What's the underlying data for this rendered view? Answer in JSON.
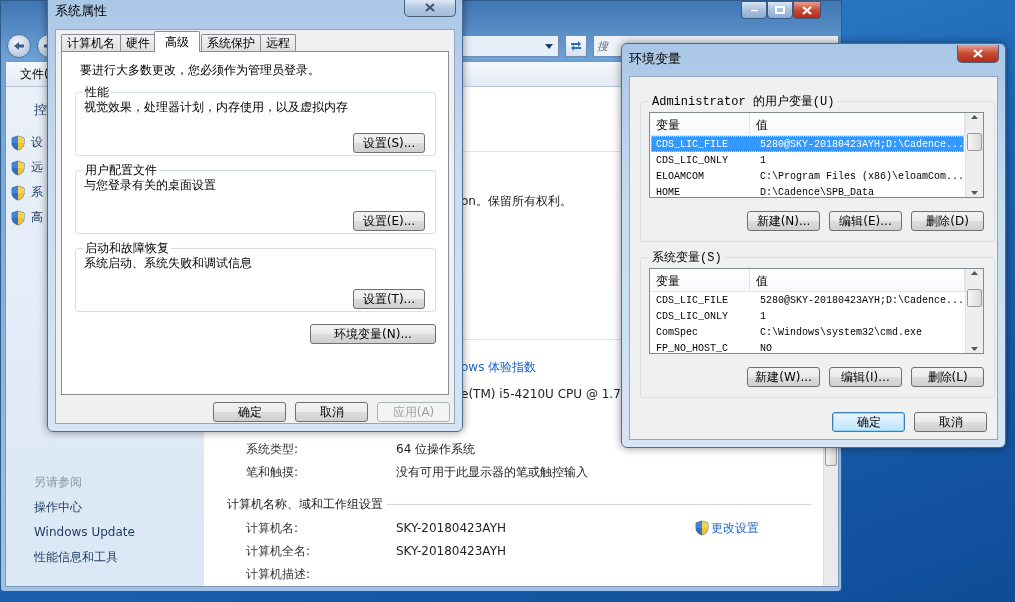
{
  "control_panel": {
    "search": {
      "placeholder": "搜"
    },
    "menu": [
      "文件("
    ],
    "sidebar": {
      "home_link": "控",
      "tasks": [
        "设",
        "远",
        "系",
        "高"
      ],
      "see_also": {
        "title": "另请参阅",
        "links": [
          "操作中心",
          "Windows Update",
          "性能信息和工具"
        ]
      }
    },
    "fragments": {
      "copyright": "on。保留所有权利。",
      "rating_link": "ows 体验指数",
      "processor": "e(TM) i5-4210U CPU @ 1.7"
    },
    "system_rows": [
      {
        "label": "系统类型:",
        "value": "64 位操作系统"
      },
      {
        "label": "笔和触摸:",
        "value": "没有可用于此显示器的笔或触控输入"
      }
    ],
    "computer_section": {
      "title": "计算机名称、域和工作组设置",
      "change_link": "更改设置",
      "rows": [
        {
          "label": "计算机名:",
          "value": "SKY-20180423AYH"
        },
        {
          "label": "计算机全名:",
          "value": "SKY-20180423AYH"
        },
        {
          "label": "计算机描述:"
        }
      ]
    }
  },
  "system_properties": {
    "title": "系统属性",
    "tabs": [
      {
        "label": "计算机名",
        "selected": false
      },
      {
        "label": "硬件",
        "selected": false
      },
      {
        "label": "高级",
        "selected": true
      },
      {
        "label": "系统保护",
        "selected": false
      },
      {
        "label": "远程",
        "selected": false
      }
    ],
    "notice": "要进行大多数更改，您必须作为管理员登录。",
    "groups": [
      {
        "title": "性能",
        "description": "视觉效果，处理器计划，内存使用，以及虚拟内存",
        "button": "设置(S)..."
      },
      {
        "title": "用户配置文件",
        "description": "与您登录有关的桌面设置",
        "button": "设置(E)..."
      },
      {
        "title": "启动和故障恢复",
        "description": "系统启动、系统失败和调试信息",
        "button": "设置(T)..."
      }
    ],
    "env_button": "环境变量(N)...",
    "buttons": [
      {
        "label": "确定",
        "disabled": false
      },
      {
        "label": "取消",
        "disabled": false
      },
      {
        "label": "应用(A)",
        "disabled": true
      }
    ]
  },
  "environment_variables": {
    "title": "环境变量",
    "lists": [
      {
        "title": "Administrator 的用户变量(U)",
        "columns": [
          "变量",
          "值"
        ],
        "rows": [
          {
            "name": "CDS_LIC_FILE",
            "value": "5280@SKY-20180423AYH;D:\\Cadence...",
            "selected": true
          },
          {
            "name": "CDS_LIC_ONLY",
            "value": "1",
            "selected": false
          },
          {
            "name": "ELOAMCOM",
            "value": "C:\\Program Files (x86)\\eloamCom...",
            "selected": false
          },
          {
            "name": "HOME",
            "value": "D:\\Cadence\\SPB_Data",
            "selected": false
          }
        ],
        "buttons": [
          "新建(N)...",
          "编辑(E)...",
          "删除(D)"
        ]
      },
      {
        "title": "系统变量(S)",
        "columns": [
          "变量",
          "值"
        ],
        "rows": [
          {
            "name": "CDS_LIC_FILE",
            "value": "5280@SKY-20180423AYH;D:\\Cadence...",
            "selected": false
          },
          {
            "name": "CDS_LIC_ONLY",
            "value": "1",
            "selected": false
          },
          {
            "name": "ComSpec",
            "value": "C:\\Windows\\system32\\cmd.exe",
            "selected": false
          },
          {
            "name": "FP_NO_HOST_C",
            "value": "NO",
            "selected": false
          }
        ],
        "buttons": [
          "新建(W)...",
          "编辑(I)...",
          "删除(L)"
        ]
      }
    ],
    "buttons": [
      {
        "label": "确定",
        "default": true
      },
      {
        "label": "取消",
        "default": false
      }
    ]
  }
}
